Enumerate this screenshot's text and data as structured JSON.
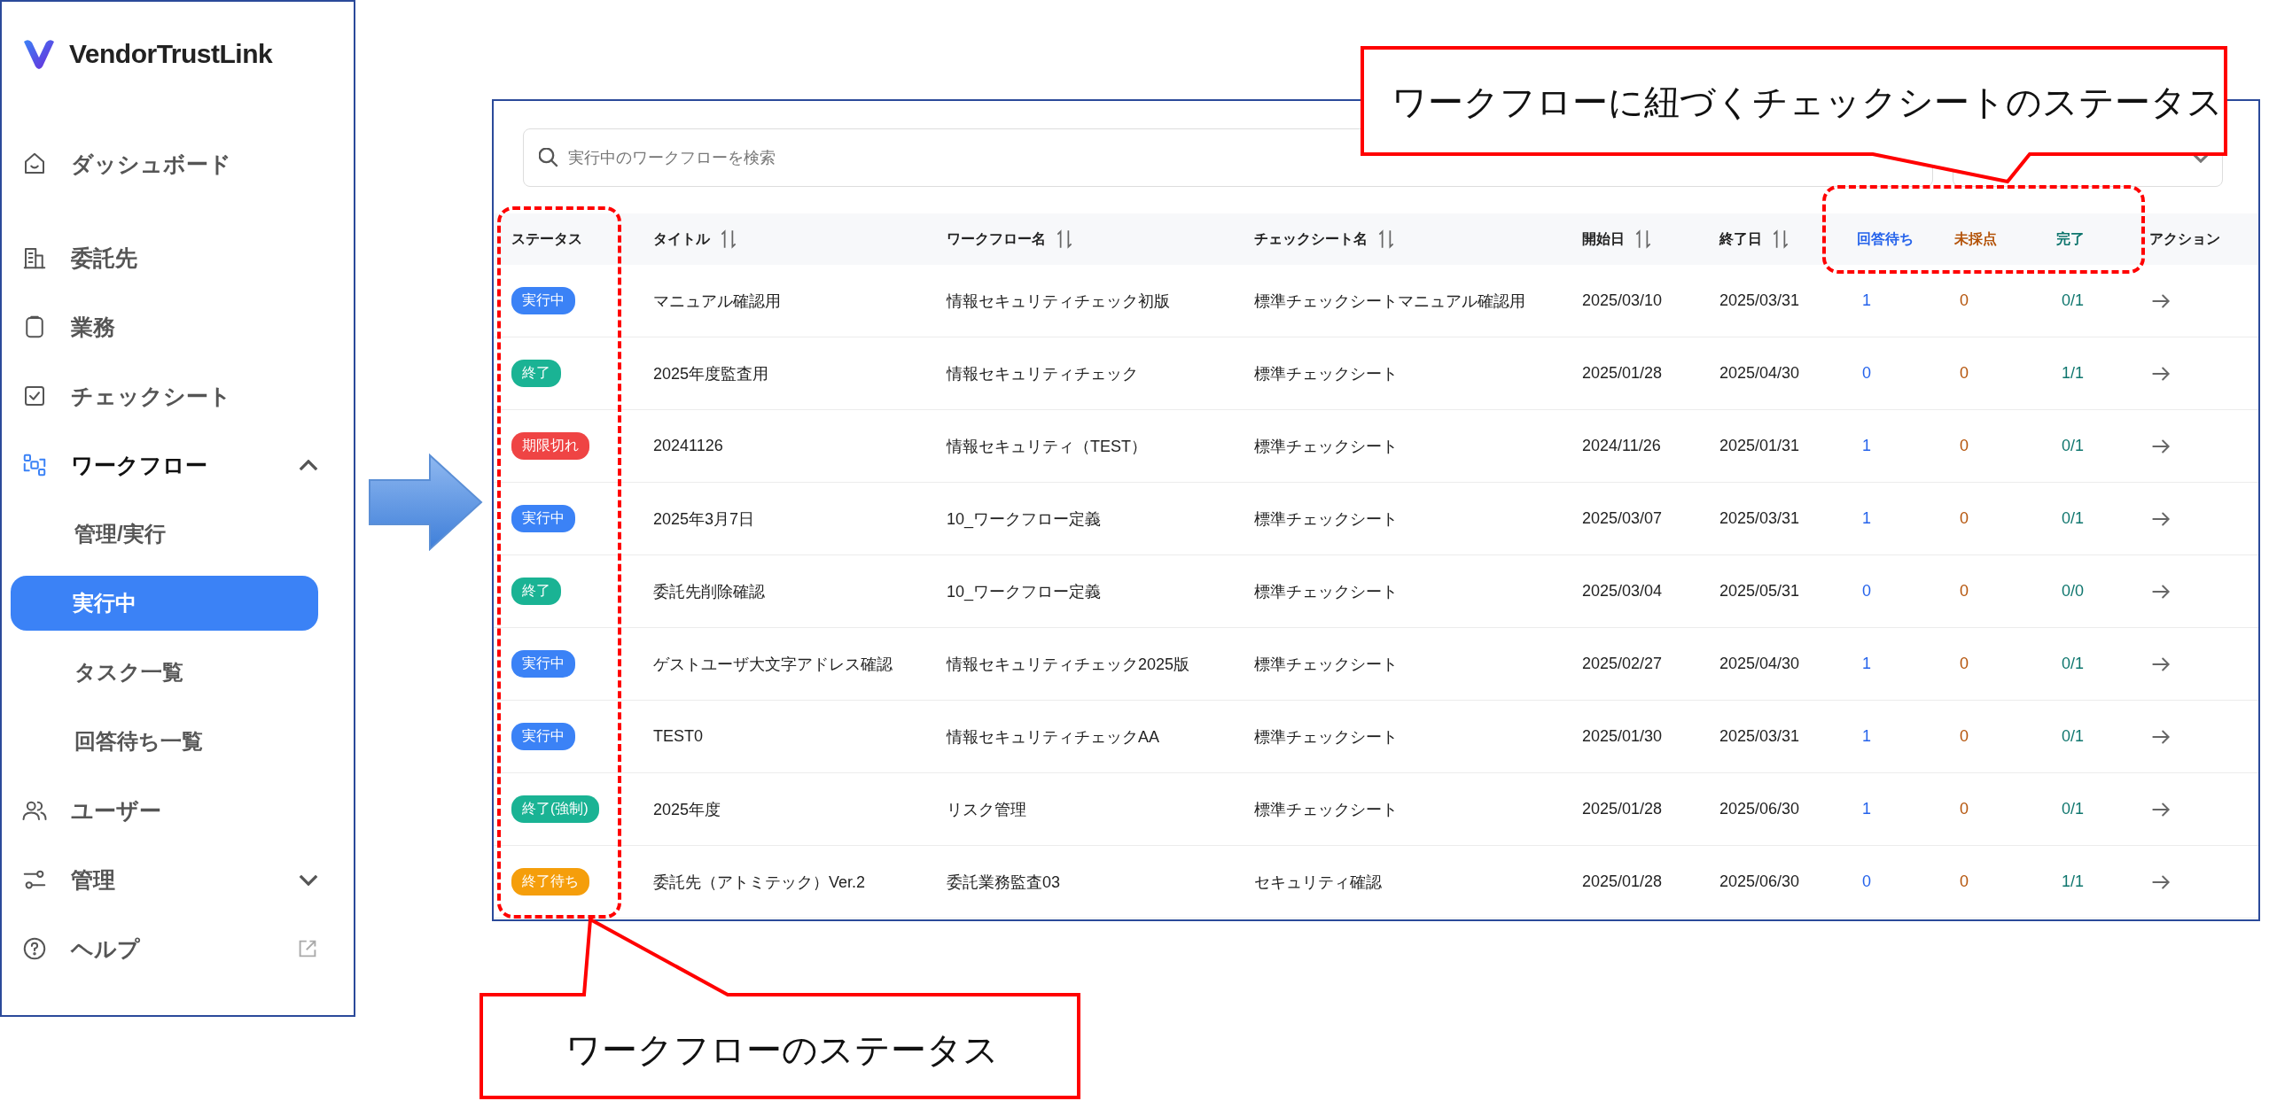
{
  "sidebar": {
    "brand": "VendorTrustLink",
    "items": [
      {
        "kind": "link",
        "label": "ダッシュボード"
      },
      {
        "kind": "link",
        "label": "委託先"
      },
      {
        "kind": "link",
        "label": "業務"
      },
      {
        "kind": "link",
        "label": "チェックシート"
      },
      {
        "kind": "group",
        "label": "ワークフロー",
        "expanded": true,
        "children": [
          {
            "label": "管理/実行",
            "selected": false
          },
          {
            "label": "実行中",
            "selected": true
          },
          {
            "label": "タスク一覧",
            "selected": false
          },
          {
            "label": "回答待ち一覧",
            "selected": false
          }
        ]
      },
      {
        "kind": "link",
        "label": "ユーザー"
      },
      {
        "kind": "group",
        "label": "管理",
        "expanded": false
      },
      {
        "kind": "external",
        "label": "ヘルプ"
      }
    ]
  },
  "search": {
    "placeholder": "実行中のワークフローを検索"
  },
  "table": {
    "columns": [
      {
        "label": "ステータス",
        "sortable": false
      },
      {
        "label": "タイトル",
        "sortable": true
      },
      {
        "label": "ワークフロー名",
        "sortable": true
      },
      {
        "label": "チェックシート名",
        "sortable": true
      },
      {
        "label": "開始日",
        "sortable": true
      },
      {
        "label": "終了日",
        "sortable": true
      },
      {
        "label": "回答待ち",
        "sortable": false,
        "color": "#2563eb"
      },
      {
        "label": "未採点",
        "sortable": false,
        "color": "#b45309"
      },
      {
        "label": "完了",
        "sortable": false,
        "color": "#0f766e"
      },
      {
        "label": "アクション",
        "sortable": false
      }
    ],
    "rows": [
      {
        "status": {
          "label": "実行中",
          "color": "#3b82f6"
        },
        "title": "マニュアル確認用",
        "workflow": "情報セキュリティチェック初版",
        "checksheet": "標準チェックシートマニュアル確認用",
        "start": "2025/03/10",
        "end": "2025/03/31",
        "waiting": "1",
        "ungraded": "0",
        "done": "0/1"
      },
      {
        "status": {
          "label": "終了",
          "color": "#1ab394"
        },
        "title": "2025年度監査用",
        "workflow": "情報セキュリティチェック",
        "checksheet": "標準チェックシート",
        "start": "2025/01/28",
        "end": "2025/04/30",
        "waiting": "0",
        "ungraded": "0",
        "done": "1/1"
      },
      {
        "status": {
          "label": "期限切れ",
          "color": "#ef4444"
        },
        "title": "20241126",
        "workflow": "情報セキュリティ（TEST）",
        "checksheet": "標準チェックシート",
        "start": "2024/11/26",
        "end": "2025/01/31",
        "waiting": "1",
        "ungraded": "0",
        "done": "0/1"
      },
      {
        "status": {
          "label": "実行中",
          "color": "#3b82f6"
        },
        "title": "2025年3月7日",
        "workflow": "10_ワークフロー定義",
        "checksheet": "標準チェックシート",
        "start": "2025/03/07",
        "end": "2025/03/31",
        "waiting": "1",
        "ungraded": "0",
        "done": "0/1"
      },
      {
        "status": {
          "label": "終了",
          "color": "#1ab394"
        },
        "title": "委託先削除確認",
        "workflow": "10_ワークフロー定義",
        "checksheet": "標準チェックシート",
        "start": "2025/03/04",
        "end": "2025/05/31",
        "waiting": "0",
        "ungraded": "0",
        "done": "0/0"
      },
      {
        "status": {
          "label": "実行中",
          "color": "#3b82f6"
        },
        "title": "ゲストユーザ大文字アドレス確認",
        "workflow": "情報セキュリティチェック2025版",
        "checksheet": "標準チェックシート",
        "start": "2025/02/27",
        "end": "2025/04/30",
        "waiting": "1",
        "ungraded": "0",
        "done": "0/1"
      },
      {
        "status": {
          "label": "実行中",
          "color": "#3b82f6"
        },
        "title": "TEST0",
        "workflow": "情報セキュリティチェックAA",
        "checksheet": "標準チェックシート",
        "start": "2025/01/30",
        "end": "2025/03/31",
        "waiting": "1",
        "ungraded": "0",
        "done": "0/1"
      },
      {
        "status": {
          "label": "終了(強制)",
          "color": "#1ab394"
        },
        "title": "2025年度",
        "workflow": "リスク管理",
        "checksheet": "標準チェックシート",
        "start": "2025/01/28",
        "end": "2025/06/30",
        "waiting": "1",
        "ungraded": "0",
        "done": "0/1"
      },
      {
        "status": {
          "label": "終了待ち",
          "color": "#f59e0b"
        },
        "title": "委託先（アトミテック）Ver.2",
        "workflow": "委託業務監査03",
        "checksheet": "セキュリティ確認",
        "start": "2025/01/28",
        "end": "2025/06/30",
        "waiting": "0",
        "ungraded": "0",
        "done": "1/1"
      }
    ]
  },
  "callouts": [
    {
      "text": "ワークフローに紐づくチェックシートのステータス"
    },
    {
      "text": "ワークフローのステータス"
    }
  ]
}
